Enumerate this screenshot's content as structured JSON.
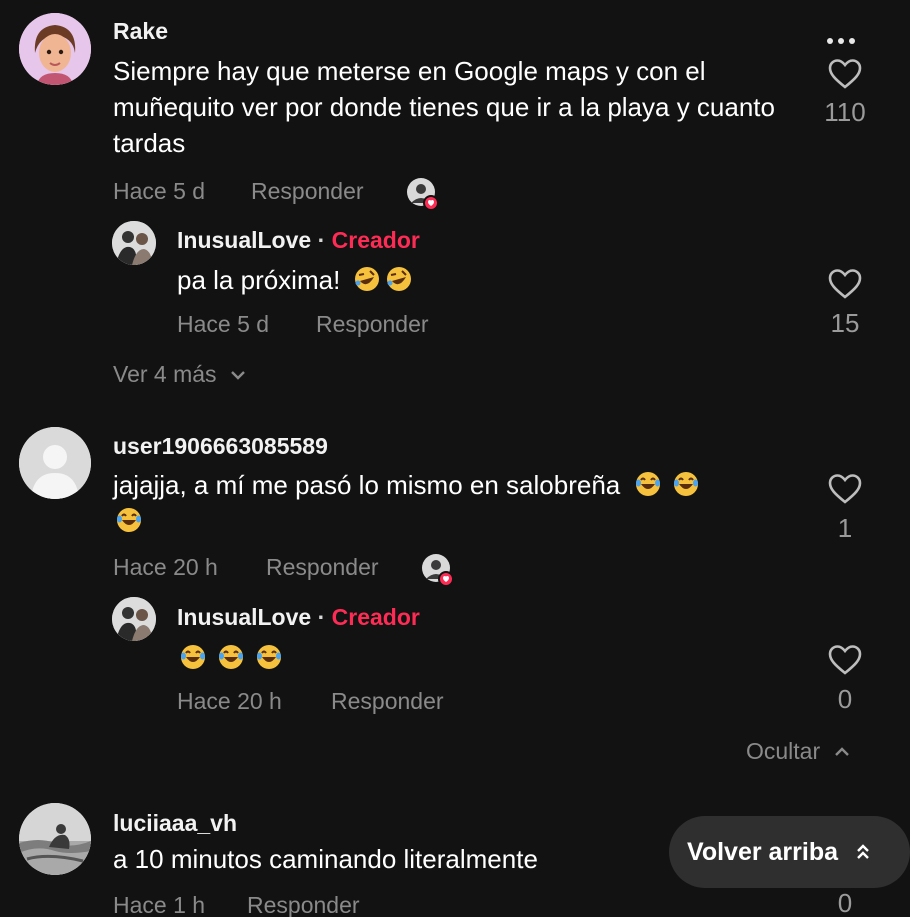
{
  "comments": [
    {
      "username": "Rake",
      "text": "Siempre hay que meterse en Google maps y con el muñequito ver por donde tienes que ir a la playa y cuanto tardas",
      "time": "Hace 5 d",
      "reply_label": "Responder",
      "likes": "110",
      "reply": {
        "username": "InusualLove",
        "separator": "·",
        "creator_label": "Creador",
        "text": "pa la próxima!",
        "time": "Hace 5 d",
        "reply_label": "Responder",
        "likes": "15"
      },
      "view_more_label": "Ver 4 más"
    },
    {
      "username": "user1906663085589",
      "text": "jajajja, a mí me pasó lo mismo en salobreña",
      "time": "Hace 20 h",
      "reply_label": "Responder",
      "likes": "1",
      "reply": {
        "username": "InusualLove",
        "separator": "·",
        "creator_label": "Creador",
        "text": "",
        "time": "Hace 20 h",
        "reply_label": "Responder",
        "likes": "0"
      },
      "hide_label": "Ocultar"
    },
    {
      "username": "luciiaaa_vh",
      "text": "a 10 minutos caminando literalmente",
      "time": "Hace 1 h",
      "reply_label": "Responder",
      "likes": "0"
    }
  ],
  "back_to_top_label": "Volver arriba",
  "colors": {
    "background": "#121212",
    "creator": "#fe2c55",
    "muted": "#8a8a8a"
  }
}
